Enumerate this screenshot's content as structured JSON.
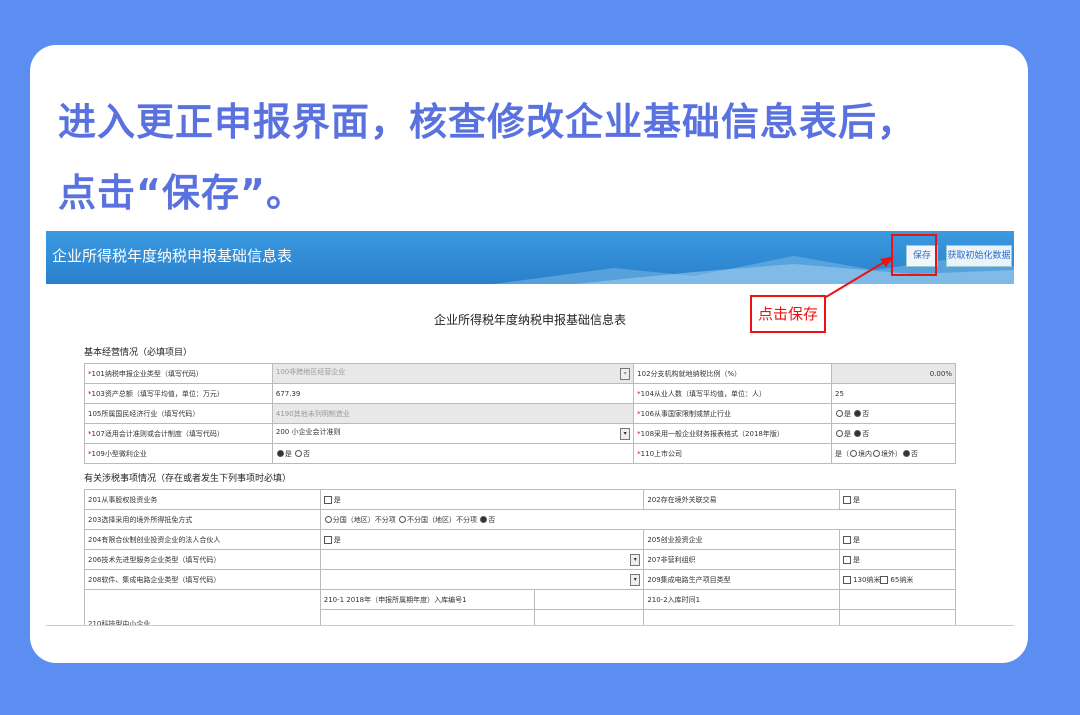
{
  "headline": {
    "line1": "进入更正申报界面，核查修改企业基础信息表后，",
    "line2": "点击“保存”。"
  },
  "banner": {
    "title": "企业所得税年度纳税申报基础信息表",
    "save_label": "保存",
    "init_label": "获取初始化数据"
  },
  "callout": "点击保存",
  "form": {
    "title": "企业所得税年度纳税申报基础信息表",
    "section1": "基本经营情况（必填项目）",
    "section2": "有关涉税事项情况（存在或者发生下列事项时必填）",
    "r101_label": "101纳税申报企业类型（填写代码）",
    "r101_value": "100非跨地区经营企业",
    "r102_label": "102分支机构就地纳税比例（%）",
    "r102_value": "0.00%",
    "r103_label": "103资产总额（填写平均值，单位：万元）",
    "r103_value": "677.39",
    "r104_label": "104从业人数（填写平均值，单位：人）",
    "r104_value": "25",
    "r105_label": "105所属国民经济行业（填写代码）",
    "r105_value": "4190其他未列明制造业",
    "r106_label": "106从事国家限制或禁止行业",
    "r107_label": "107适用会计准则或会计制度（填写代码）",
    "r107_value": "200 小企业会计准则",
    "r108_label": "108采用一般企业财务报表格式（2018年版）",
    "r109_label": "109小型微利企业",
    "r110_label": "110上市公司",
    "opt_yes": "是",
    "opt_no": "否",
    "opt_domestic": "境内",
    "opt_foreign": "境外",
    "r201_label": "201从事股权投资业务",
    "r202_label": "202存在境外关联交易",
    "r203_label": "203选择采用的境外所得抵免方式",
    "r203_opt1": "分国（地区）不分项",
    "r203_opt2": "不分国（地区）不分项",
    "r204_label": "204有限合伙制创业投资企业的法人合伙人",
    "r205_label": "205创业投资企业",
    "r206_label": "206技术先进型服务企业类型（填写代码）",
    "r207_label": "207非营利组织",
    "r208_label": "208软件、集成电路企业类型（填写代码）",
    "r209_label": "209集成电路生产项目类型",
    "r209_opt1": "130纳米",
    "r209_opt2": "65纳米",
    "r210_label": "210科技型中小企业",
    "r210_1_label": "210-1  2018年（申报所属期年度）入库编号1",
    "r210_2_label": "210-2入库时间1"
  }
}
